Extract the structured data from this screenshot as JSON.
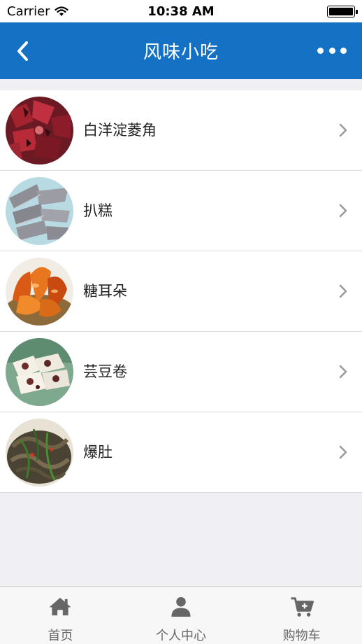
{
  "status_bar": {
    "carrier": "Carrier",
    "time": "10:38 AM"
  },
  "nav": {
    "title": "风味小吃",
    "back_icon": "chevron-left-icon",
    "more_icon": "more-dots-icon"
  },
  "colors": {
    "nav_background": "#1571c4",
    "page_background": "#efeff4"
  },
  "items": [
    {
      "label": "白洋淀菱角",
      "image": "red-water-caltrops"
    },
    {
      "label": "扒糕",
      "image": "gray-buckwheat-cake-slices"
    },
    {
      "label": "糖耳朵",
      "image": "glazed-fried-pastry"
    },
    {
      "label": "芸豆卷",
      "image": "kidney-bean-rolls"
    },
    {
      "label": "爆肚",
      "image": "quick-boiled-tripe"
    }
  ],
  "tabs": [
    {
      "label": "首页",
      "icon": "home-icon"
    },
    {
      "label": "个人中心",
      "icon": "user-icon"
    },
    {
      "label": "购物车",
      "icon": "cart-icon"
    }
  ]
}
